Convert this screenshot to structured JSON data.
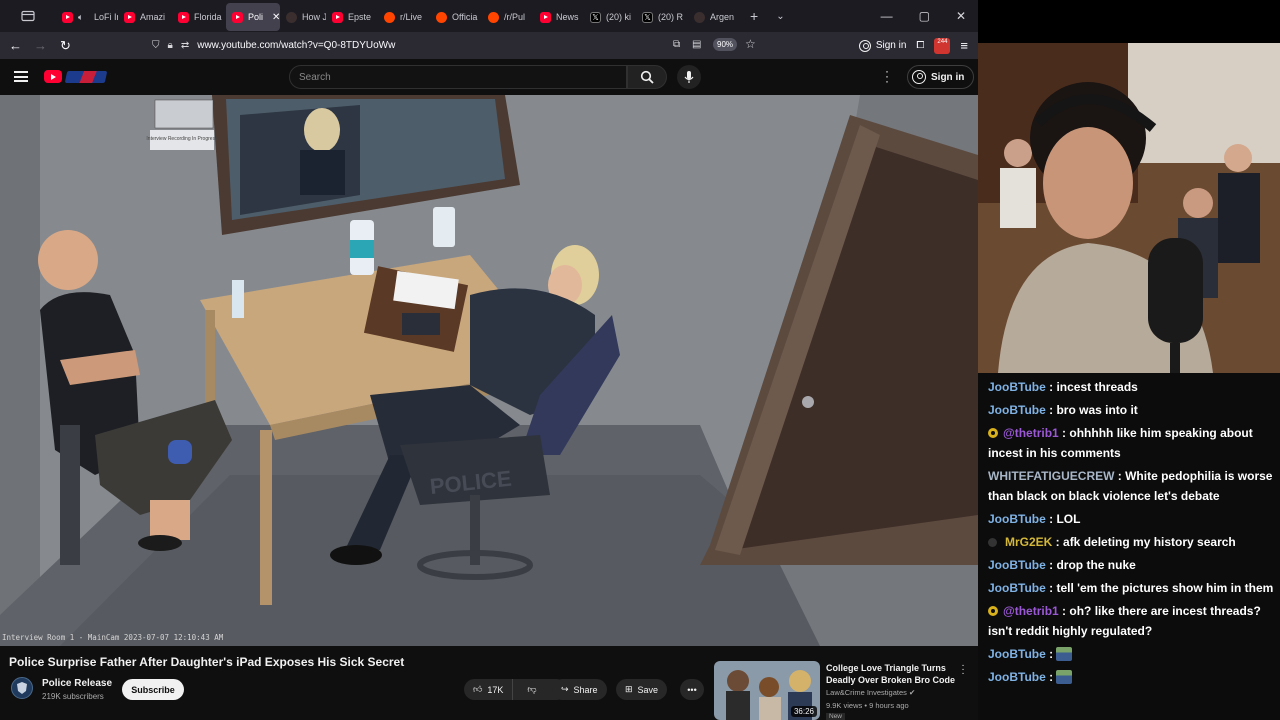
{
  "browser": {
    "tabs": [
      {
        "label": "",
        "favicon": "tab-groups-icon"
      },
      {
        "label": "LoFi In",
        "favicon": "youtube-icon",
        "audio": true
      },
      {
        "label": "Amazi",
        "favicon": "youtube-icon"
      },
      {
        "label": "Florida",
        "favicon": "youtube-icon"
      },
      {
        "label": "Poli",
        "favicon": "youtube-icon",
        "active": true
      },
      {
        "label": "How J",
        "favicon": "generic-icon"
      },
      {
        "label": "Epste",
        "favicon": "youtube-icon"
      },
      {
        "label": "r/Live",
        "favicon": "reddit-icon"
      },
      {
        "label": "Officia",
        "favicon": "reddit-icon"
      },
      {
        "label": "/r/Pul",
        "favicon": "reddit-icon"
      },
      {
        "label": "News",
        "favicon": "youtube-icon"
      },
      {
        "label": "(20) ki",
        "favicon": "x-icon"
      },
      {
        "label": "(20) R",
        "favicon": "x-icon"
      },
      {
        "label": "Argen",
        "favicon": "generic-icon"
      }
    ],
    "url": "www.youtube.com/watch?v=Q0-8TDYUoWw",
    "zoom": "90%",
    "signin_label": "Sign in",
    "extension_badge": "244"
  },
  "youtube": {
    "search_placeholder": "Search",
    "signin_label": "Sign in",
    "video_title": "Police Surprise Father After Daughter's iPad Exposes His Sick Secret",
    "camera_overlay": "Interview Room 1 - MainCam 2023-07-07 12:10:43 AM",
    "room_sign": "Interview Recording In Progress",
    "chair_text": "POLICE",
    "channel_name": "Police Release",
    "subscribers": "219K subscribers",
    "subscribe_label": "Subscribe",
    "likes": "17K",
    "share_label": "Share",
    "save_label": "Save",
    "recommendation": {
      "title": "College Love Triangle Turns Deadly Over Broken Bro Code",
      "channel": "Law&Crime Investigates",
      "views": "9.9K views",
      "age": "9 hours ago",
      "badge": "New",
      "duration": "36:26"
    }
  },
  "chat": {
    "messages": [
      {
        "user": "JooBTube",
        "color": "#7fb2e5",
        "text": "incest threads",
        "badge": ""
      },
      {
        "user": "JooBTube",
        "color": "#7fb2e5",
        "text": "bro was into it",
        "badge": ""
      },
      {
        "user": "@thetrib1",
        "color": "#9b59d6",
        "text": "ohhhhh like him speaking about incest in his comments",
        "badge": "gold"
      },
      {
        "user": "WHITEFATIGUECREW",
        "color": "#a8b6c7",
        "text": "White pedophilia is worse than black on black violence let's debate",
        "badge": ""
      },
      {
        "user": "JooBTube",
        "color": "#7fb2e5",
        "text": "LOL",
        "badge": ""
      },
      {
        "user": "MrG2EK",
        "color": "#d4b83a",
        "text": "afk deleting my history search",
        "badge": "moon"
      },
      {
        "user": "JooBTube",
        "color": "#7fb2e5",
        "text": "drop the nuke",
        "badge": ""
      },
      {
        "user": "JooBTube",
        "color": "#7fb2e5",
        "text": "tell 'em the pictures show him in them",
        "badge": ""
      },
      {
        "user": "@thetrib1",
        "color": "#9b59d6",
        "text": "oh? like there are incest threads? isn't reddit highly regulated?",
        "badge": "gold"
      },
      {
        "user": "JooBTube",
        "color": "#7fb2e5",
        "text": "",
        "badge": "",
        "emote": true
      },
      {
        "user": "JooBTube",
        "color": "#7fb2e5",
        "text": "",
        "badge": "",
        "emote": true
      }
    ]
  }
}
